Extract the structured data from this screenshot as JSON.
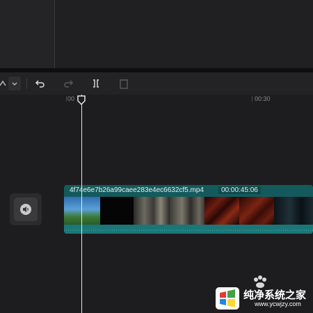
{
  "ruler": {
    "mark_label": "00:30"
  },
  "clip": {
    "name": "4f74e6e7b26a99caee283e4ec6632cf5.mp4",
    "duration": "00:00:45:06"
  },
  "toolbar": {
    "icons": [
      "split-mode-icon",
      "chevron-down-icon",
      "undo-icon",
      "redo-icon",
      "split-icon",
      "delete-icon"
    ]
  },
  "watermark": {
    "title": "纯净系统之家",
    "url": "www.ycwjzy.com"
  }
}
